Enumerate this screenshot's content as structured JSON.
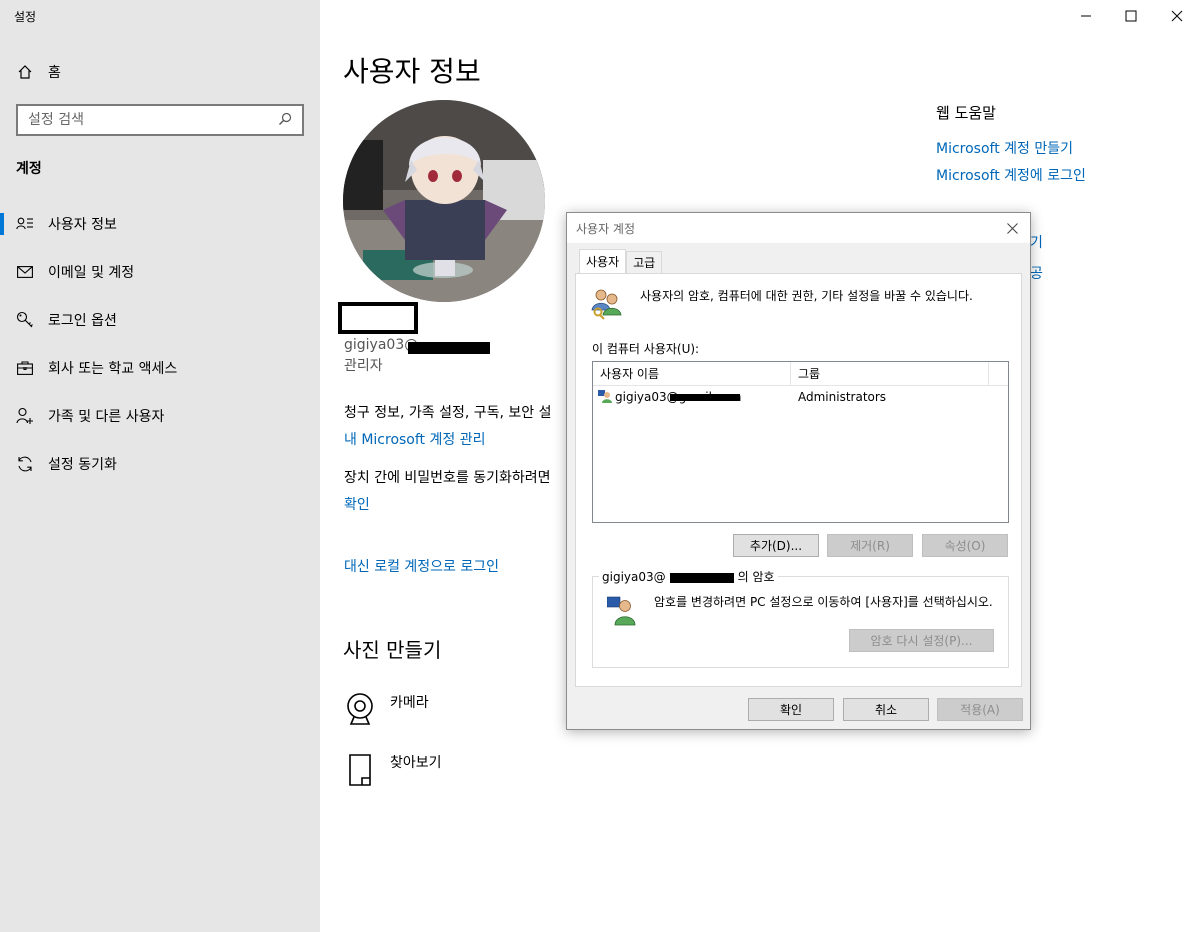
{
  "app": {
    "title": "설정"
  },
  "sidebar": {
    "home_label": "홈",
    "search_placeholder": "설정 검색",
    "section_title": "계정",
    "items": [
      {
        "label": "사용자 정보",
        "icon": "user-info-icon",
        "active": true
      },
      {
        "label": "이메일 및 계정",
        "icon": "mail-icon",
        "active": false
      },
      {
        "label": "로그인 옵션",
        "icon": "key-icon",
        "active": false
      },
      {
        "label": "회사 또는 학교 액세스",
        "icon": "briefcase-icon",
        "active": false
      },
      {
        "label": "가족 및 다른 사용자",
        "icon": "person-add-icon",
        "active": false
      },
      {
        "label": "설정 동기화",
        "icon": "sync-icon",
        "active": false
      }
    ]
  },
  "main": {
    "title": "사용자 정보",
    "email": "gigiya03@",
    "role": "관리자",
    "billing_text": "청구 정보, 가족 설정, 구독, 보안 설",
    "manage_link": "내 Microsoft 계정 관리",
    "sync_text": "장치 간에 비밀번호를 동기화하려면",
    "verify_link": "확인",
    "local_link": "대신 로컬 계정으로 로그인",
    "photo_title": "사진 만들기",
    "camera_label": "카메라",
    "browse_label": "찾아보기"
  },
  "help": {
    "title": "웹 도움말",
    "links": [
      "Microsoft 계정 만들기",
      "Microsoft 계정에 로그인"
    ],
    "partial_links": [
      "기",
      "공"
    ]
  },
  "dialog": {
    "title": "사용자 계정",
    "tabs": [
      "사용자",
      "고급"
    ],
    "description": "사용자의 암호, 컴퓨터에 대한 권한, 기타 설정을 바꿀 수 있습니다.",
    "users_label": "이 컴퓨터 사용자(U):",
    "columns": [
      "사용자 이름",
      "그룹"
    ],
    "rows": [
      {
        "name": "gigiya03@gmail.com",
        "group": "Administrators"
      }
    ],
    "add_button": "추가(D)...",
    "remove_button": "제거(R)",
    "properties_button": "속성(O)",
    "password_group_prefix": "gigiya03@",
    "password_group_suffix": "의 암호",
    "password_text": "암호를 변경하려면 PC 설정으로 이동하여 [사용자]를 선택하십시오.",
    "reset_button": "암호 다시 설정(P)...",
    "ok_button": "확인",
    "cancel_button": "취소",
    "apply_button": "적용(A)"
  },
  "colors": {
    "accent": "#0078d7",
    "link": "#0067b8",
    "sidebar_bg": "#e6e6e6"
  }
}
